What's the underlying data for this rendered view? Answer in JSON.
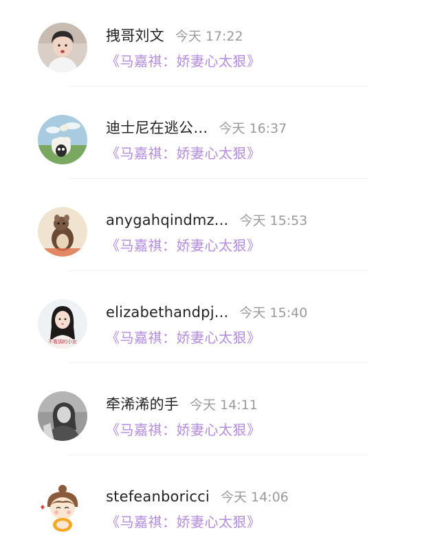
{
  "comments": [
    {
      "name": "拽哥刘文",
      "time": "今天 17:22",
      "book": "《马嘉祺：娇妻心太狠》",
      "avatar": "young-man-avatar"
    },
    {
      "name": "迪士尼在逃公…",
      "time": "今天 16:37",
      "book": "《马嘉祺：娇妻心太狠》",
      "avatar": "sheep-cartoon-avatar"
    },
    {
      "name": "anygahqindmz...",
      "time": "今天 15:53",
      "book": "《马嘉祺：娇妻心太狠》",
      "avatar": "hamster-avatar"
    },
    {
      "name": "elizabethandpj...",
      "time": "今天 15:40",
      "book": "《马嘉祺：娇妻心太狠》",
      "avatar": "girl-photo-avatar",
      "avatar_caption": "不看調的小女"
    },
    {
      "name": "牵浠浠的手",
      "time": "今天 14:11",
      "book": "《马嘉祺：娇妻心太狠》",
      "avatar": "bw-photo-avatar"
    },
    {
      "name": "stefeanboricci",
      "time": "今天 14:06",
      "book": "《马嘉祺：娇妻心太狠》",
      "avatar": "cartoon-girl-avatar"
    }
  ]
}
